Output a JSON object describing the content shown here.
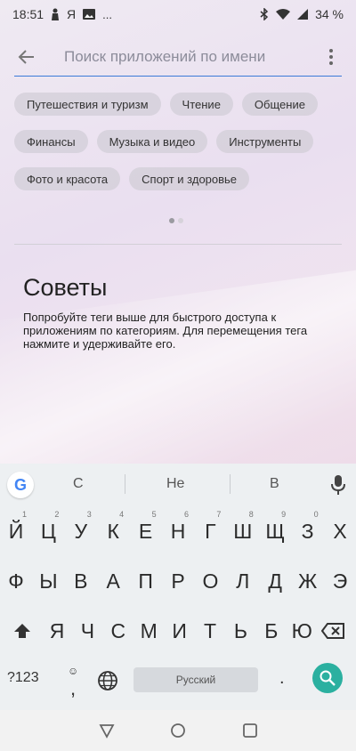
{
  "status_bar": {
    "time": "18:51",
    "notif_yandex": "Я",
    "more": "...",
    "battery": "34 %"
  },
  "search": {
    "placeholder": "Поиск приложений по имени"
  },
  "chips": [
    [
      "Путешествия и туризм",
      "Чтение",
      "Общение"
    ],
    [
      "Финансы",
      "Музыка и видео",
      "Инструменты"
    ],
    [
      "Фото и красота",
      "Спорт и здоровье"
    ]
  ],
  "tips": {
    "title": "Советы",
    "body": "Попробуйте теги выше для быстрого доступа к приложениям по категориям. Для перемещения тега нажмите и удерживайте его."
  },
  "keyboard": {
    "suggestions": [
      "С",
      "Не",
      "В"
    ],
    "row1": [
      {
        "key": "Й",
        "hint": "1"
      },
      {
        "key": "Ц",
        "hint": "2"
      },
      {
        "key": "У",
        "hint": "3"
      },
      {
        "key": "К",
        "hint": "4"
      },
      {
        "key": "Е",
        "hint": "5"
      },
      {
        "key": "Н",
        "hint": "6"
      },
      {
        "key": "Г",
        "hint": "7"
      },
      {
        "key": "Ш",
        "hint": "8"
      },
      {
        "key": "Щ",
        "hint": "9"
      },
      {
        "key": "З",
        "hint": "0"
      },
      {
        "key": "Х",
        "hint": ""
      }
    ],
    "row2": [
      "Ф",
      "Ы",
      "В",
      "А",
      "П",
      "Р",
      "О",
      "Л",
      "Д",
      "Ж",
      "Э"
    ],
    "row3": [
      "Я",
      "Ч",
      "С",
      "М",
      "И",
      "Т",
      "Ь",
      "Б",
      "Ю"
    ],
    "sym_label": "?123",
    "comma": ",",
    "space_label": "Русский",
    "period": "."
  },
  "icons": {
    "back": "arrow-left-icon",
    "menu": "more-vert-icon",
    "mic": "mic-icon",
    "globe": "globe-icon",
    "search": "search-icon",
    "shift": "shift-icon",
    "backspace": "backspace-icon"
  },
  "colors": {
    "accent": "#3b7ad8",
    "search_key": "#2bb0a0"
  }
}
